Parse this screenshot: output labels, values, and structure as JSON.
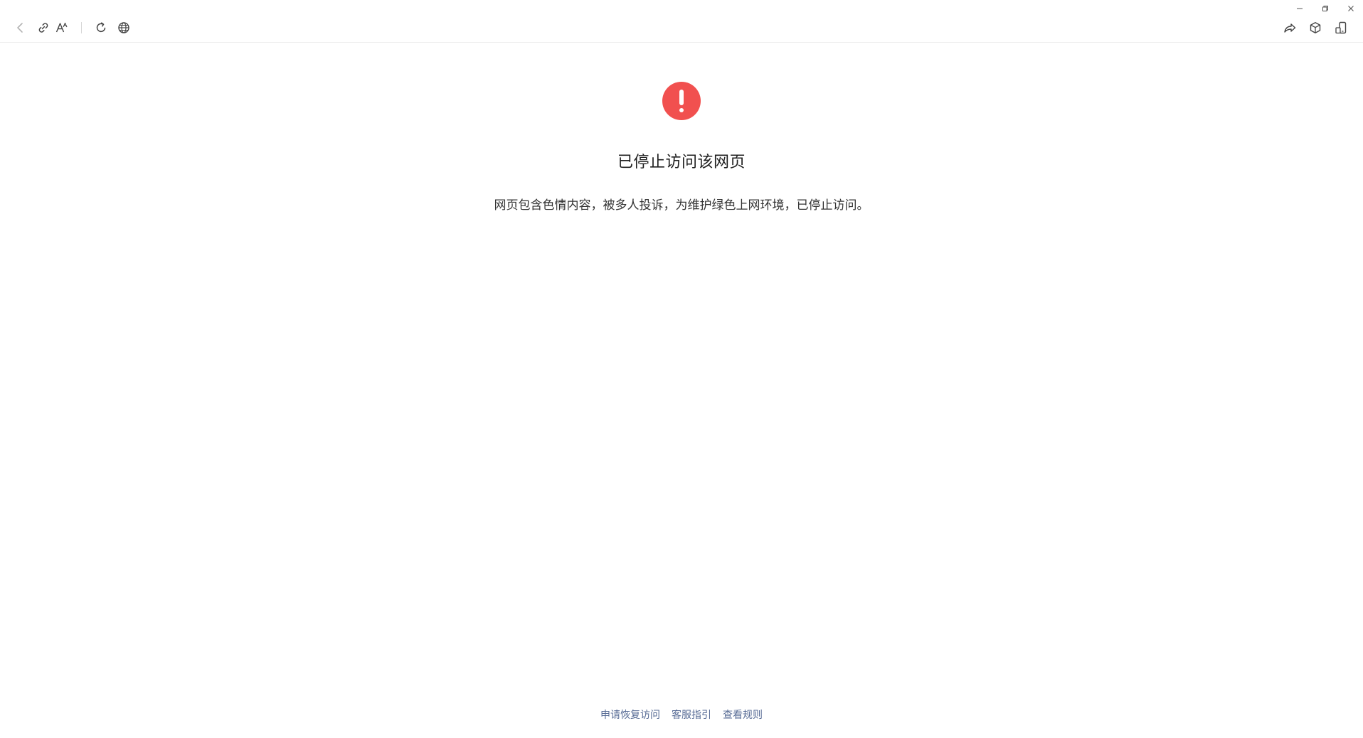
{
  "window_controls": {
    "minimize_icon": "minimize-icon",
    "restore_icon": "restore-icon",
    "close_icon": "close-icon"
  },
  "toolbar": {
    "left_icons": [
      "back-arrow-icon",
      "link-icon",
      "font-size-icon",
      "refresh-icon",
      "globe-icon"
    ],
    "right_icons": [
      "share-icon",
      "cube-icon",
      "phone-icon"
    ]
  },
  "main": {
    "alert_icon": "exclamation-circle-icon",
    "alert_color": "#f1504f",
    "title": "已停止访问该网页",
    "description": "网页包含色情内容，被多人投诉，为维护绿色上网环境，已停止访问。"
  },
  "footer": {
    "links": [
      {
        "label": "申请恢复访问"
      },
      {
        "label": "客服指引"
      },
      {
        "label": "查看规则"
      }
    ],
    "link_color": "#576b95"
  }
}
